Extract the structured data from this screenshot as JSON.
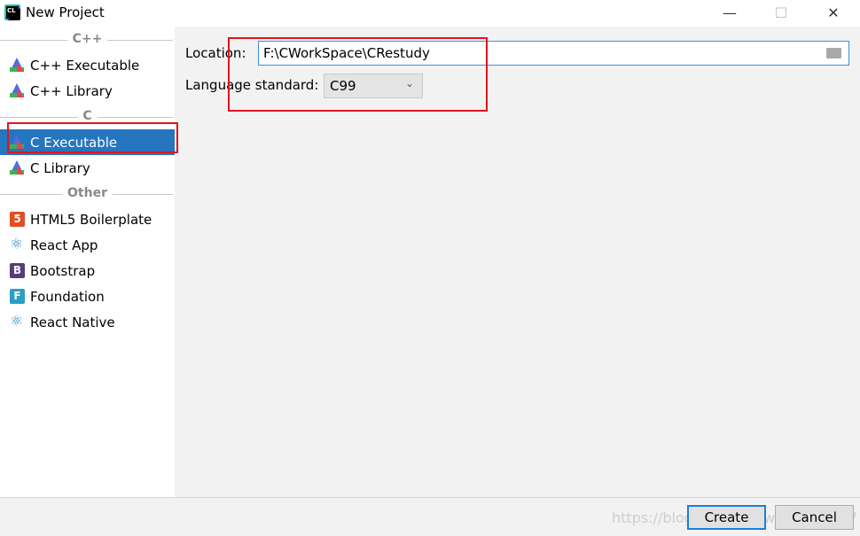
{
  "window": {
    "title": "New Project",
    "app_icon_text": "CL",
    "minimize": "—",
    "maximize": "☐",
    "close": "✕"
  },
  "sidebar": {
    "groups": [
      {
        "label": "C++",
        "items": [
          {
            "label": "C++ Executable",
            "icon": "clion-triangle-icon"
          },
          {
            "label": "C++ Library",
            "icon": "clion-triangle-icon"
          }
        ]
      },
      {
        "label": "C",
        "items": [
          {
            "label": "C Executable",
            "icon": "clion-triangle-icon",
            "selected": true
          },
          {
            "label": "C Library",
            "icon": "clion-triangle-icon"
          }
        ]
      },
      {
        "label": "Other",
        "items": [
          {
            "label": "HTML5 Boilerplate",
            "icon": "html5-icon",
            "icon_text": "5"
          },
          {
            "label": "React App",
            "icon": "react-icon",
            "icon_text": "⚛"
          },
          {
            "label": "Bootstrap",
            "icon": "bootstrap-icon",
            "icon_text": "B"
          },
          {
            "label": "Foundation",
            "icon": "foundation-icon",
            "icon_text": "F"
          },
          {
            "label": "React Native",
            "icon": "react-icon",
            "icon_text": "⚛"
          }
        ]
      }
    ]
  },
  "form": {
    "location_label": "Location:",
    "location_value": "F:\\CWorkSpace\\CRestudy",
    "language_label": "Language standard:",
    "language_value": "C99"
  },
  "footer": {
    "create": "Create",
    "cancel": "Cancel"
  },
  "watermark": "https://blog.csdn.net/weixin_4…07",
  "colors": {
    "selection": "#2675bf",
    "highlight_box": "#e0141e"
  }
}
